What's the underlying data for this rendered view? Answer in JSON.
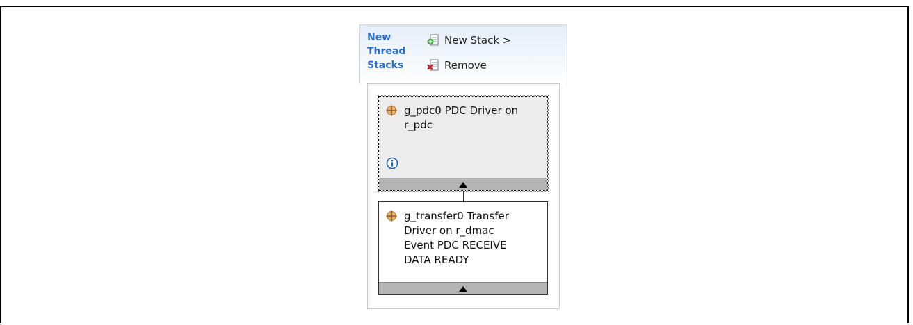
{
  "panel": {
    "title_lines": [
      "New",
      "Thread",
      "Stacks"
    ],
    "actions": {
      "new_stack_label": "New Stack >",
      "remove_label": "Remove"
    }
  },
  "stack": {
    "modules": [
      {
        "lines": [
          "g_pdc0 PDC Driver on",
          "r_pdc"
        ],
        "selected": true,
        "has_info": true
      },
      {
        "lines": [
          "g_transfer0 Transfer",
          "Driver on r_dmac",
          "Event PDC RECEIVE",
          "DATA READY"
        ],
        "selected": false,
        "has_info": false
      }
    ]
  },
  "colors": {
    "title": "#2a6fc9",
    "footer": "#b4b4b4",
    "module_icon": "#c8863a"
  }
}
